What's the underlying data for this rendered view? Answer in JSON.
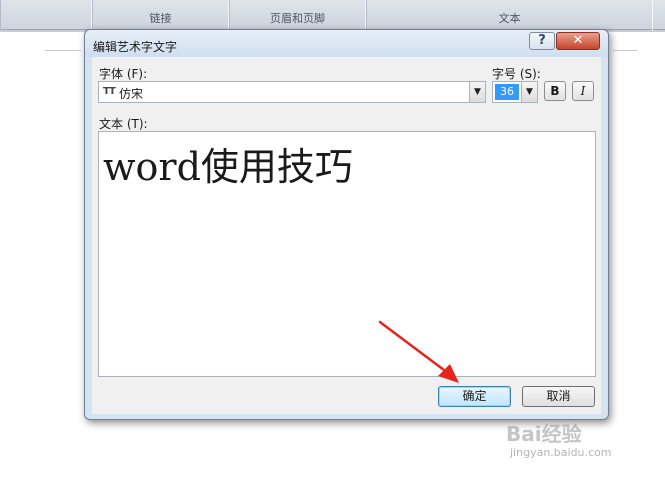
{
  "ribbon": {
    "groups": [
      "",
      "链接",
      "页眉和页脚",
      "文本",
      ""
    ]
  },
  "dialog": {
    "title": "编辑艺术字文字",
    "help_label": "?",
    "close_label": "✕",
    "font_label": "字体 (F):",
    "font_value": "仿宋",
    "font_type_glyph": "TT",
    "size_label": "字号 (S):",
    "size_value": "36",
    "bold_label": "B",
    "italic_label": "I",
    "text_label": "文本 (T):",
    "text_value": "word使用技巧",
    "ok_label": "确定",
    "cancel_label": "取消"
  },
  "watermark": {
    "brand": "Bai经验",
    "url": "jingyan.baidu.com"
  },
  "colors": {
    "accent": "#3399ff",
    "arrow": "#e8231e"
  }
}
